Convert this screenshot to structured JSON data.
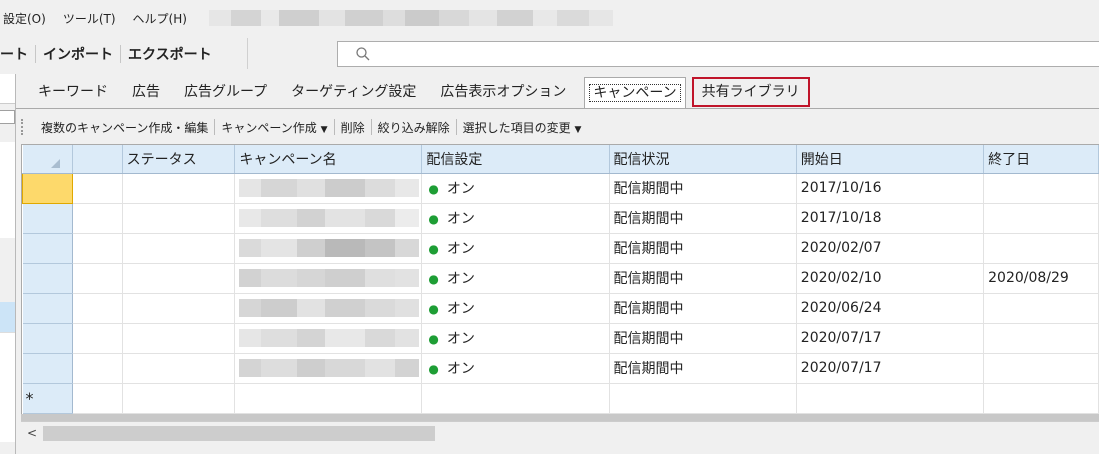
{
  "menu": {
    "items": [
      "設定(O)",
      "ツール(T)",
      "ヘルプ(H)"
    ]
  },
  "toolbar": {
    "export_partial": "ート",
    "import": "インポート",
    "export": "エクスポート"
  },
  "search": {
    "placeholder": ""
  },
  "tabs": [
    {
      "label": "キーワード"
    },
    {
      "label": "広告"
    },
    {
      "label": "広告グループ"
    },
    {
      "label": "ターゲティング設定"
    },
    {
      "label": "広告表示オプション"
    },
    {
      "label": "キャンペーン",
      "active": true
    },
    {
      "label": "共有ライブラリ",
      "highlighted": true
    }
  ],
  "actions": {
    "bulk_create_edit": "複数のキャンペーン作成・編集",
    "create_campaign": "キャンペーン作成",
    "delete": "削除",
    "clear_filter": "絞り込み解除",
    "change_selected": "選択した項目の変更"
  },
  "grid": {
    "columns": [
      "",
      "ステータス",
      "キャンペーン名",
      "配信設定",
      "配信状況",
      "開始日",
      "終了日"
    ],
    "rows": [
      {
        "status": "",
        "name": "",
        "delivery_setting": "オン",
        "delivery_status": "配信期間中",
        "start": "2017/10/16",
        "end": ""
      },
      {
        "status": "",
        "name": "",
        "delivery_setting": "オン",
        "delivery_status": "配信期間中",
        "start": "2017/10/18",
        "end": ""
      },
      {
        "status": "",
        "name": "",
        "delivery_setting": "オン",
        "delivery_status": "配信期間中",
        "start": "2020/02/07",
        "end": ""
      },
      {
        "status": "",
        "name": "",
        "delivery_setting": "オン",
        "delivery_status": "配信期間中",
        "start": "2020/02/10",
        "end": "2020/08/29"
      },
      {
        "status": "",
        "name": "",
        "delivery_setting": "オン",
        "delivery_status": "配信期間中",
        "start": "2020/06/24",
        "end": ""
      },
      {
        "status": "",
        "name": "",
        "delivery_setting": "オン",
        "delivery_status": "配信期間中",
        "start": "2020/07/17",
        "end": ""
      },
      {
        "status": "",
        "name": "",
        "delivery_setting": "オン",
        "delivery_status": "配信期間中",
        "start": "2020/07/17",
        "end": ""
      }
    ],
    "new_row_marker": "*"
  },
  "scrollbar": {
    "left_arrow": "<"
  },
  "colors": {
    "status_on": "#1e9e35",
    "highlight_border": "#c0142a",
    "selected_row_header": "#fdd96b",
    "header_bg": "#dcebf8"
  }
}
